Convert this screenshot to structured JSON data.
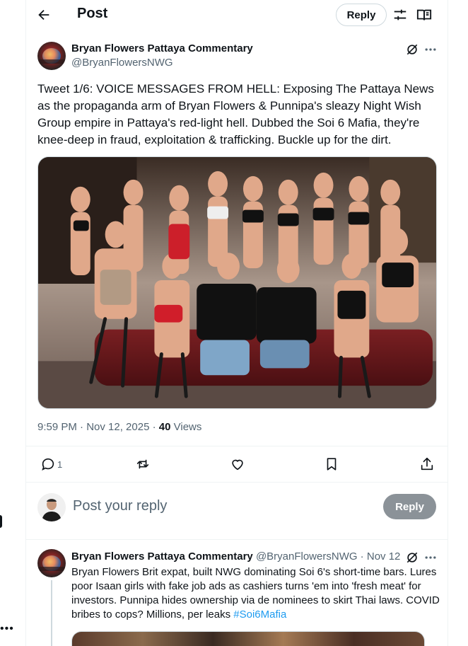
{
  "header": {
    "title": "Post",
    "reply_button": "Reply",
    "back_icon": "arrow-left-icon",
    "sliders_icon": "sliders-icon",
    "reader_icon": "reader-mode-icon"
  },
  "post": {
    "author_name": "Bryan Flowers Pattaya Commentary",
    "author_handle": "@BryanFlowersNWG",
    "text": "Tweet 1/6: VOICE MESSAGES FROM HELL: Exposing The Pattaya News as the propaganda arm of Bryan Flowers & Punnipa's sleazy Night Wish Group empire in Pattaya's red-light hell. Dubbed the Soi 6 Mafia, they're knee-deep in fraud, exploitation & trafficking. Buckle up for the dirt.",
    "timestamp": "9:59 PM · Nov 12, 2025",
    "dot": " · ",
    "views_count": "40",
    "views_label": " Views",
    "media_icon": "photo",
    "actions": {
      "reply_count": "1",
      "reply_icon": "comment-icon",
      "repost_icon": "repost-icon",
      "like_icon": "heart-icon",
      "bookmark_icon": "bookmark-icon",
      "share_icon": "share-icon"
    }
  },
  "reply_box": {
    "placeholder": "Post your reply",
    "submit_label": "Reply"
  },
  "reply": {
    "author_name": "Bryan Flowers Pattaya Commentary",
    "author_handle": "@BryanFlowersNWG",
    "separator": " · ",
    "date": "Nov 12",
    "text": "Bryan Flowers Brit expat, built NWG dominating Soi 6's short-time bars. Lures poor Isaan girls with fake job ads as cashiers turns 'em into 'fresh meat' for investors. Punnipa hides ownership via de nominees to skirt Thai laws. COVID bribes to cops? Millions, per leaks ",
    "hashtag": "#Soi6Mafia"
  },
  "colors": {
    "text_primary": "#0f1419",
    "text_secondary": "#536471",
    "link": "#1d9bf0",
    "border": "#cfd9de",
    "reply_button_disabled": "#8b9298"
  }
}
